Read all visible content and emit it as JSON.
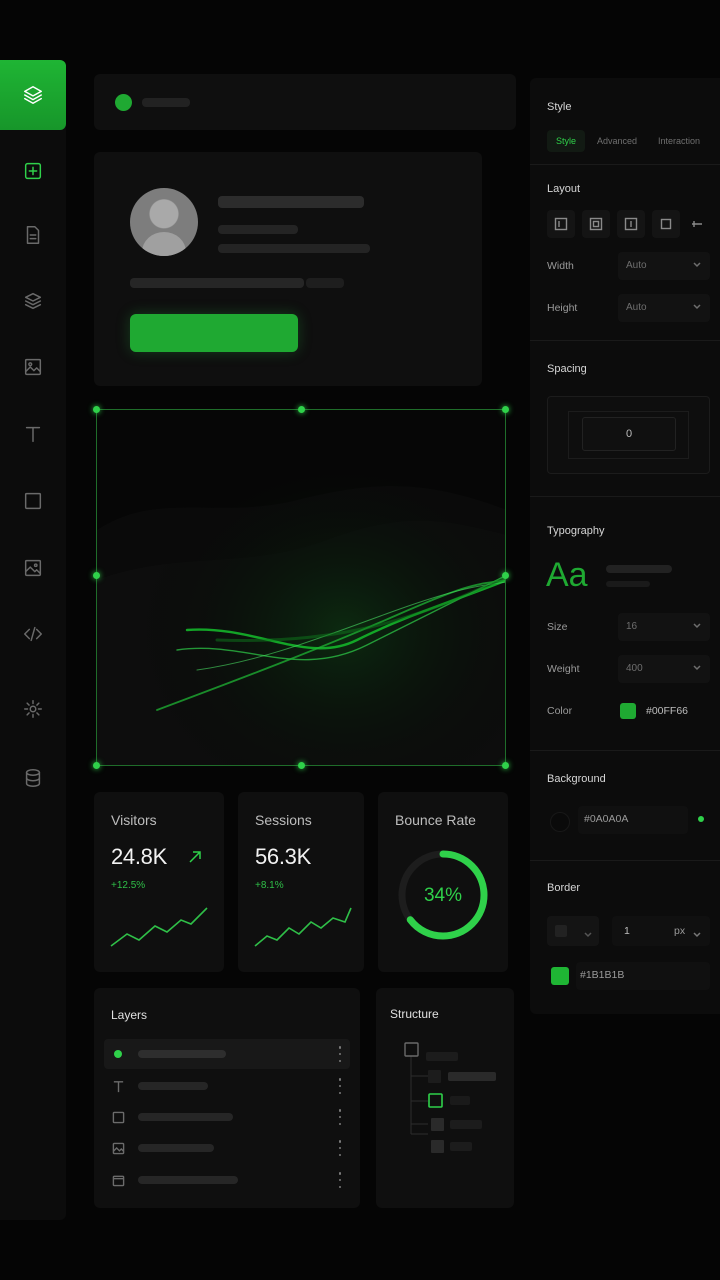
{
  "toolbar": {
    "tools": [
      "layers-stack-icon",
      "add-element-icon",
      "page-icon",
      "layers-icon",
      "image-icon",
      "text-icon",
      "box-icon",
      "media-icon",
      "code-icon",
      "settings-gear-icon",
      "database-icon"
    ],
    "active_tool": "layers-stack-icon"
  },
  "colors": {
    "accent": "#1FB534",
    "accent_bright": "#2FD14A",
    "background": "#050505",
    "panel": "#0F0F0F"
  },
  "stats": [
    {
      "label": "Visitors",
      "value": "24.8K",
      "delta": "+12.5%",
      "trend_icon": "arrow-up-right-icon"
    },
    {
      "label": "Sessions",
      "value": "56.3K",
      "delta": "+8.1%"
    },
    {
      "label": "Bounce Rate",
      "value": "34%",
      "progress": 0.34
    }
  ],
  "layers": {
    "title": "Layers",
    "items": [
      {
        "icon": "dot-icon",
        "selected": true
      },
      {
        "icon": "text-icon"
      },
      {
        "icon": "box-icon"
      },
      {
        "icon": "image-icon"
      },
      {
        "icon": "container-icon"
      }
    ]
  },
  "structure": {
    "title": "Structure"
  },
  "properties": {
    "header": "Style",
    "tabs": [
      "Style",
      "Advanced",
      "Interaction"
    ],
    "active_tab": "Style",
    "layout": {
      "title": "Layout",
      "width_label": "Width",
      "width_value": "Auto",
      "height_label": "Height",
      "height_value": "Auto"
    },
    "spacing": {
      "title": "Spacing",
      "value": "0"
    },
    "typography": {
      "title": "Typography",
      "preview": "Aa",
      "size_label": "Size",
      "size_value": "16",
      "weight_label": "Weight",
      "weight_value": "400",
      "color_label": "Color",
      "color_value": "#00FF66"
    },
    "background": {
      "title": "Background",
      "value": "#0A0A0A"
    },
    "border": {
      "title": "Border",
      "width": "1",
      "unit": "px",
      "color_value": "#1B1B1B"
    }
  }
}
